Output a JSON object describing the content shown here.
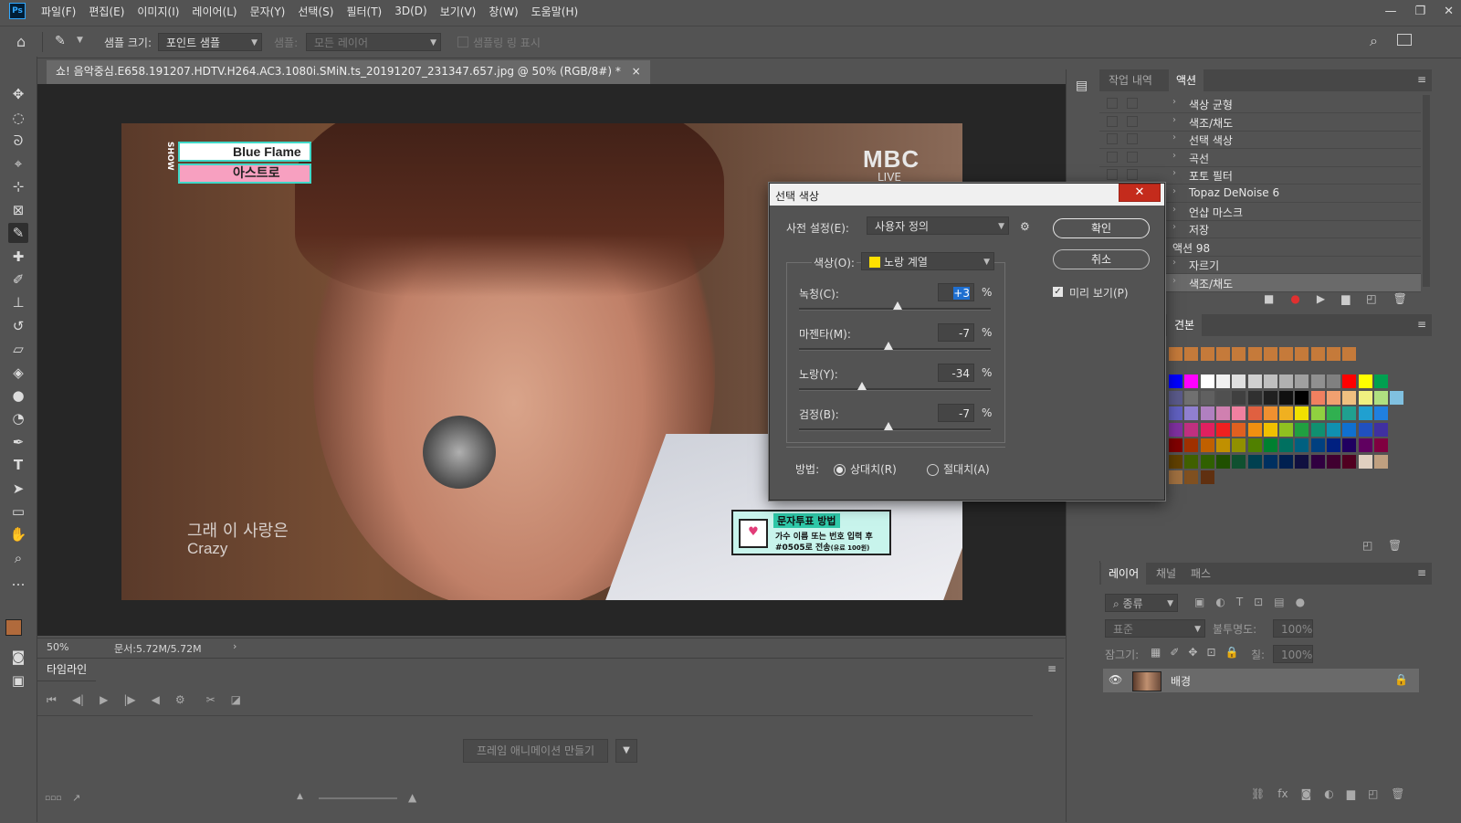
{
  "app": {
    "logo": "Ps"
  },
  "menubar": {
    "items": [
      "파일(F)",
      "편집(E)",
      "이미지(I)",
      "레이어(L)",
      "문자(Y)",
      "선택(S)",
      "필터(T)",
      "3D(D)",
      "보기(V)",
      "창(W)",
      "도움말(H)"
    ],
    "window_controls": [
      "—",
      "❐",
      "✕"
    ]
  },
  "options_bar": {
    "sample_size_label": "샘플 크기:",
    "sample_size_value": "포인트 샘플",
    "sample_label": "샘플:",
    "sample_value": "모든 레이어",
    "show_ring_label": "샘플링 링 표시"
  },
  "document": {
    "tab_title": "쇼! 음악중심.E658.191207.HDTV.H264.AC3.1080i.SMiN.ts_20191207_231347.657.jpg @ 50% (RGB/8#) *",
    "close_glyph": "×",
    "zoom": "50%",
    "doc_size": "문서:5.72M/5.72M",
    "overlay": {
      "show_logo_1": "Blue Flame",
      "show_logo_2": "아스트로",
      "show_vert": "SHOW",
      "broadcaster": "MBC",
      "broadcaster_sub": "LIVE",
      "subtitle_1": "그래 이 사랑은",
      "subtitle_2": "Crazy",
      "vote_title": "문자투표 방법",
      "vote_line1": "가수 이름 또는 번호 입력 후",
      "vote_line2": "#0505로 전송",
      "vote_fee": "(유료 100원)"
    }
  },
  "timeline": {
    "tab_label": "타임라인",
    "create_button": "프레임 애니메이션 만들기"
  },
  "actions_panel": {
    "tabs": [
      "작업 내역",
      "액션"
    ],
    "active_tab": 1,
    "rows": [
      {
        "label": "색상 균형",
        "has_chevron": true,
        "selected": false
      },
      {
        "label": "색조/채도",
        "has_chevron": true,
        "selected": false
      },
      {
        "label": "선택 색상",
        "has_chevron": true,
        "selected": false
      },
      {
        "label": "곡선",
        "has_chevron": true,
        "selected": false
      },
      {
        "label": "포토 필터",
        "has_chevron": true,
        "selected": false
      },
      {
        "label": "Topaz DeNoise 6",
        "has_chevron": true,
        "selected": false
      },
      {
        "label": "언샵 마스크",
        "has_chevron": true,
        "selected": false
      },
      {
        "label": "저장",
        "has_chevron": true,
        "selected": false
      },
      {
        "label": "액션 98",
        "has_chevron": false,
        "selected": false
      },
      {
        "label": "자르기",
        "has_chevron": true,
        "selected": false
      },
      {
        "label": "색조/채도",
        "has_chevron": true,
        "selected": true
      }
    ]
  },
  "swatches_panel": {
    "tab_label": "견본",
    "rows": [
      [
        "#c57a3a",
        "#c57a3a",
        "#c57a3a",
        "#c57a3a",
        "#c57a3a",
        "#c57a3a",
        "#c57a3a",
        "#c57a3a",
        "#c57a3a",
        "#c57a3a",
        "#c57a3a",
        "#c57a3a"
      ],
      [
        "#0000ff",
        "#ff00ff",
        "#ffffff",
        "#f0f0f0",
        "#e0e0e0",
        "#d0d0d0",
        "#c0c0c0",
        "#b0b0b0",
        "#a0a0a0",
        "#909090",
        "#808080",
        "#ff0000",
        "#ffff00",
        "#00a050"
      ],
      [
        "#5a5a8a",
        "#707070",
        "#606060",
        "#505050",
        "#404040",
        "#303030",
        "#202020",
        "#101010",
        "#000000",
        "#f08060",
        "#f0a070",
        "#f0c080",
        "#f0f080",
        "#b0e080",
        "#80c0e0"
      ],
      [
        "#6060c0",
        "#9080d0",
        "#b080c0",
        "#d080b0",
        "#f080a0",
        "#e06040",
        "#f09030",
        "#f0b020",
        "#f0e000",
        "#90d040",
        "#30b050",
        "#20a090",
        "#20a0d0",
        "#2080e0"
      ],
      [
        "#8030a0",
        "#c03080",
        "#e02060",
        "#f02020",
        "#e06020",
        "#f09010",
        "#f0c000",
        "#90c020",
        "#20a040",
        "#109070",
        "#1090b0",
        "#1070d0",
        "#2050c0",
        "#4030a0"
      ],
      [
        "#800000",
        "#a03000",
        "#c06000",
        "#c09000",
        "#909000",
        "#508000",
        "#008030",
        "#007060",
        "#006080",
        "#004080",
        "#002080",
        "#200060",
        "#600060",
        "#800040"
      ],
      [
        "#604000",
        "#406000",
        "#306000",
        "#205000",
        "#105030",
        "#004050",
        "#003060",
        "#002050",
        "#101040",
        "#300040",
        "#400030",
        "#500020",
        "#e0d0c0",
        "#c0a080"
      ],
      [
        "#a07040",
        "#805020",
        "#603010"
      ]
    ]
  },
  "layers_panel": {
    "tabs": [
      "레이어",
      "채널",
      "패스"
    ],
    "active_tab": 0,
    "filter_kind": "종류",
    "blend_mode": "표준",
    "opacity_label": "불투명도:",
    "opacity_value": "100%",
    "lock_label": "잠그기:",
    "fill_label": "칠:",
    "fill_value": "100%",
    "layer_name": "배경"
  },
  "dialog": {
    "title": "선택 색상",
    "close_glyph": "✕",
    "preset_label": "사전 설정(E):",
    "preset_value": "사용자 정의",
    "ok_button": "확인",
    "cancel_button": "취소",
    "preview_label": "미리 보기(P)",
    "preview_checked": true,
    "colors_label": "색상(O):",
    "colors_value": "노랑 계열",
    "colors_swatch": "#ffe000",
    "sliders": [
      {
        "label": "녹청(C):",
        "value": "+3",
        "unit": "%",
        "level": 0.515
      },
      {
        "label": "마젠타(M):",
        "value": "-7",
        "unit": "%",
        "level": 0.465
      },
      {
        "label": "노랑(Y):",
        "value": "-34",
        "unit": "%",
        "level": 0.33
      },
      {
        "label": "검정(B):",
        "value": "-7",
        "unit": "%",
        "level": 0.465
      }
    ],
    "method_label": "방법:",
    "method_relative": "상대치(R)",
    "method_absolute": "절대치(A)",
    "method_selected": "relative"
  }
}
